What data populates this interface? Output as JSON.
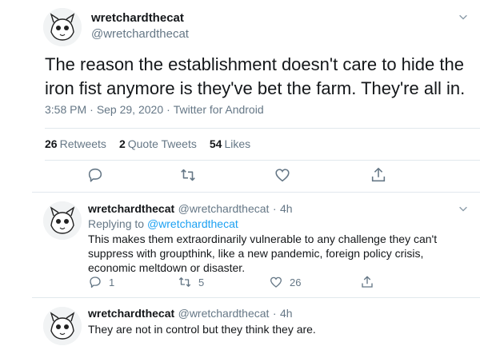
{
  "tweet": {
    "display_name": "wretchardthecat",
    "handle": "@wretchardthecat",
    "text": "The reason the establishment doesn't care to hide the iron fist anymore is they've bet the farm. They're all in.",
    "time": "3:58 PM",
    "date": "Sep 29, 2020",
    "client": "Twitter for Android",
    "stats": {
      "retweets_count": "26",
      "retweets_label": "Retweets",
      "quotes_count": "2",
      "quotes_label": "Quote Tweets",
      "likes_count": "54",
      "likes_label": "Likes"
    }
  },
  "replies": [
    {
      "display_name": "wretchardthecat",
      "handle": "@wretchardthecat",
      "age": "4h",
      "replying_prefix": "Replying to",
      "replying_to": "@wretchardthecat",
      "text": "This makes them extraordinarily vulnerable to any challenge they can't suppress with groupthink,  like a new pandemic,  foreign policy crisis, economic meltdown or disaster.",
      "reply_count": "1",
      "retweet_count": "5",
      "like_count": "26"
    },
    {
      "display_name": "wretchardthecat",
      "handle": "@wretchardthecat",
      "age": "4h",
      "text": "They are not in control but they think they are."
    }
  ],
  "separator": "·",
  "colors": {
    "text": "#14171a",
    "secondary": "#657786",
    "accent": "#1da1f2",
    "divider": "#e1e8ed"
  }
}
